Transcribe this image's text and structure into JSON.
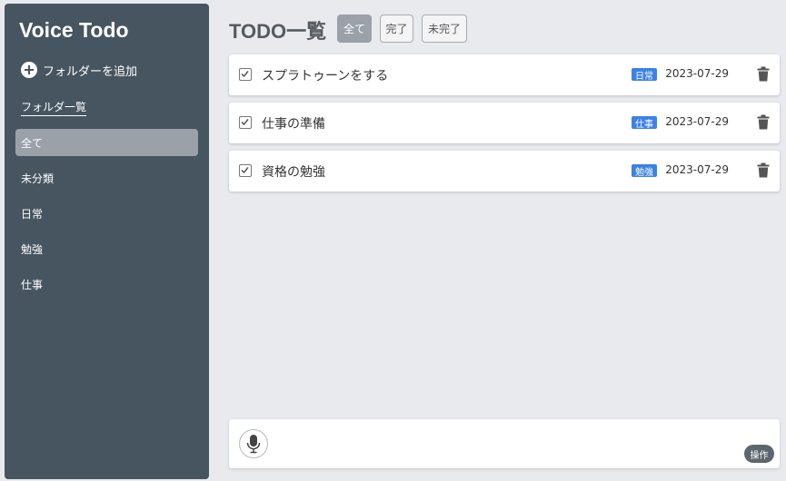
{
  "sidebar": {
    "app_title": "Voice Todo",
    "add_folder_label": "フォルダーを追加",
    "folder_list_label": "フォルダ一覧",
    "folders": [
      {
        "label": "全て",
        "active": true
      },
      {
        "label": "未分類",
        "active": false
      },
      {
        "label": "日常",
        "active": false
      },
      {
        "label": "勉強",
        "active": false
      },
      {
        "label": "仕事",
        "active": false
      }
    ]
  },
  "main": {
    "title": "TODO一覧",
    "filters": [
      {
        "label": "全て",
        "active": true
      },
      {
        "label": "完了",
        "active": false
      },
      {
        "label": "未完了",
        "active": false
      }
    ],
    "todos": [
      {
        "title": "スプラトゥーンをする",
        "tag": "日常",
        "date": "2023-07-29",
        "checked": true
      },
      {
        "title": "仕事の準備",
        "tag": "仕事",
        "date": "2023-07-29",
        "checked": true
      },
      {
        "title": "資格の勉強",
        "tag": "勉強",
        "date": "2023-07-29",
        "checked": true
      }
    ]
  },
  "input_bar": {
    "action_label": "操作"
  },
  "icons": {
    "add": "plus-circle-icon",
    "checkbox": "checkbox-checked-icon",
    "delete": "trash-icon",
    "voice": "microphone-icon"
  },
  "colors": {
    "sidebar_bg": "#475560",
    "tag_bg": "#3b82e6",
    "active_filter_bg": "#9aa1a9"
  }
}
